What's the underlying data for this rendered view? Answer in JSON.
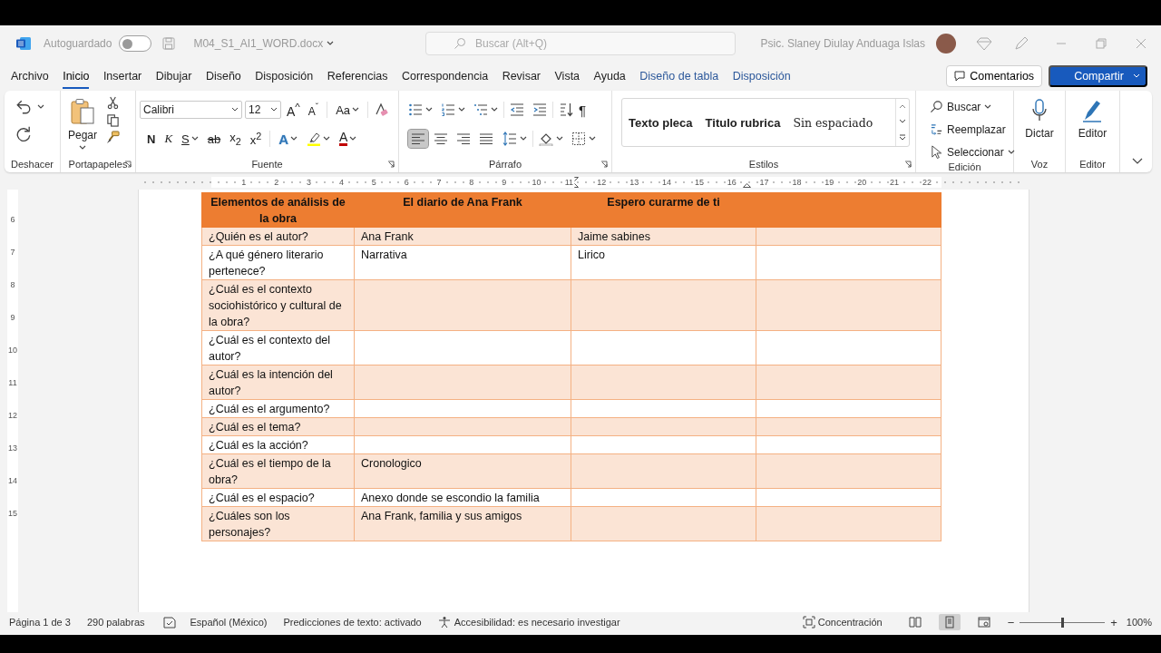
{
  "title_bar": {
    "autosave_label": "Autoguardado",
    "autosave_on": false,
    "file_name": "M04_S1_AI1_WORD.docx",
    "search_placeholder": "Buscar (Alt+Q)",
    "user_name": "Psic. Slaney Diulay Anduaga Islas"
  },
  "menu_tabs": [
    {
      "label": "Archivo",
      "selected": false,
      "contextual": false
    },
    {
      "label": "Inicio",
      "selected": true,
      "contextual": false
    },
    {
      "label": "Insertar",
      "selected": false,
      "contextual": false
    },
    {
      "label": "Dibujar",
      "selected": false,
      "contextual": false
    },
    {
      "label": "Diseño",
      "selected": false,
      "contextual": false
    },
    {
      "label": "Disposición",
      "selected": false,
      "contextual": false
    },
    {
      "label": "Referencias",
      "selected": false,
      "contextual": false
    },
    {
      "label": "Correspondencia",
      "selected": false,
      "contextual": false
    },
    {
      "label": "Revisar",
      "selected": false,
      "contextual": false
    },
    {
      "label": "Vista",
      "selected": false,
      "contextual": false
    },
    {
      "label": "Ayuda",
      "selected": false,
      "contextual": false
    },
    {
      "label": "Diseño de tabla",
      "selected": false,
      "contextual": true
    },
    {
      "label": "Disposición",
      "selected": false,
      "contextual": true
    }
  ],
  "comments_button": "Comentarios",
  "share_button": "Compartir",
  "ribbon": {
    "group_labels": [
      "Deshacer",
      "Portapapeles",
      "Fuente",
      "Párrafo",
      "Estilos",
      "Edición",
      "Voz",
      "Editor"
    ],
    "paste": "Pegar",
    "font_name": "Calibri",
    "font_size": "12",
    "grow_font": "A$^{^}$",
    "shrink_font": "A$^{ˇ}$",
    "change_case": "Aa",
    "format_buttons": [
      {
        "kind": "bold",
        "label": "N",
        "menu": false
      },
      {
        "kind": "italic",
        "label": "K",
        "menu": false
      },
      {
        "kind": "underline",
        "label": "S",
        "menu": true
      },
      {
        "kind": "strike",
        "label": "ab",
        "menu": false
      },
      {
        "kind": "subscript",
        "label": "x$_{2}$",
        "menu": false
      },
      {
        "kind": "superscript",
        "label": "x$^{2}$",
        "menu": false
      },
      {
        "kind": "effects",
        "label": "A",
        "menu": true
      },
      {
        "kind": "highlight",
        "menu": true
      },
      {
        "kind": "color",
        "label": "A",
        "menu": true
      }
    ],
    "show_marks": "¶",
    "align_buttons": [
      {
        "selected": true
      },
      {
        "selected": false
      },
      {
        "selected": false
      },
      {
        "selected": false
      }
    ],
    "styles": [
      {
        "label": "Texto pleca",
        "kind": "heading"
      },
      {
        "label": "Titulo rubrica",
        "kind": "heading"
      },
      {
        "label": "Sin espaciado",
        "kind": "body"
      }
    ],
    "editing": [
      "Buscar",
      "Reemplazar",
      "Seleccionar"
    ],
    "dictate": "Dictar",
    "editor": "Editor"
  },
  "ruler_numbers": [
    "1",
    "2",
    "3",
    "4",
    "5",
    "6",
    "7",
    "8",
    "9",
    "10",
    "11",
    "12",
    "13",
    "14",
    "15",
    "16",
    "17",
    "18",
    "19",
    "20",
    "21",
    "22"
  ],
  "vertical_ruler_numbers": [
    "6",
    "7",
    "8",
    "9",
    "10",
    "11",
    "12",
    "13",
    "14",
    "15"
  ],
  "table": {
    "header": [
      "Elementos de análisis de la obra",
      "El diario de Ana Frank",
      "Espero curarme de ti"
    ],
    "rows": [
      {
        "cells": [
          "¿Quién es el autor?",
          "Ana Frank",
          "Jaime sabines"
        ]
      },
      {
        "cells": [
          "¿A qué género literario pertenece?",
          "Narrativa",
          "Lirico"
        ]
      },
      {
        "cells": [
          "¿Cuál es el contexto sociohistórico y cultural de la obra?"
        ]
      },
      {
        "cells": [
          "¿Cuál es el contexto del autor?"
        ]
      },
      {
        "cells": [
          "¿Cuál es la intención del autor?"
        ]
      },
      {
        "cells": [
          "¿Cuál es el argumento?"
        ]
      },
      {
        "cells": [
          "¿Cuál es el tema?"
        ]
      },
      {
        "cells": [
          "¿Cuál es la acción?"
        ]
      },
      {
        "cells": [
          "¿Cuál es el tiempo de la obra?",
          "Cronologico"
        ]
      },
      {
        "cells": [
          "¿Cuál es el espacio?",
          "Anexo donde se escondio la familia"
        ]
      },
      {
        "cells": [
          "¿Cuáles son los personajes?",
          "Ana Frank, familia y sus amigos"
        ]
      }
    ]
  },
  "status_bar": {
    "page": "Página 1 de 3",
    "words": "290 palabras",
    "language": "Español (México)",
    "predictions": "Predicciones de texto: activado",
    "accessibility": "Accesibilidad: es necesario investigar",
    "focus": "Concentración",
    "views": [
      {
        "selected": false
      },
      {
        "selected": true
      },
      {
        "selected": false
      }
    ],
    "zoom_out": "−",
    "zoom_in": "+",
    "zoom": {
      "level": 0.5,
      "reading": "100%"
    }
  }
}
